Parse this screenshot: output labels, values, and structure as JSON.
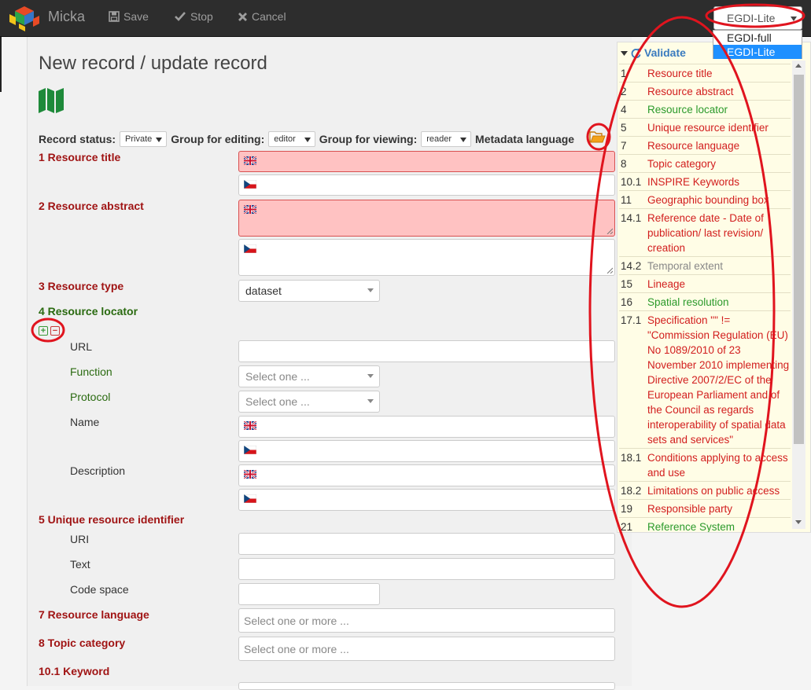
{
  "app": {
    "brand": "Micka",
    "toolbar": {
      "save_label": "Save",
      "stop_label": "Stop",
      "cancel_label": "Cancel"
    },
    "profile": {
      "selected": "EGDI-Lite",
      "options": [
        "EGDI-full",
        "EGDI-Lite"
      ]
    }
  },
  "page": {
    "title": "New record / update record"
  },
  "status_bar": {
    "record_status_label": "Record status:",
    "record_status_value": "Private",
    "group_editing_label": "Group for editing:",
    "group_editing_value": "editor",
    "group_viewing_label": "Group for viewing:",
    "group_viewing_value": "reader",
    "metadata_language_label": "Metadata language"
  },
  "form": {
    "resource_title": "1 Resource title",
    "resource_abstract": "2 Resource abstract",
    "resource_type": {
      "label": "3 Resource type",
      "value": "dataset"
    },
    "resource_locator": {
      "label": "4 Resource locator",
      "url_label": "URL",
      "function_label": "Function",
      "function_placeholder": "Select one ...",
      "protocol_label": "Protocol",
      "protocol_placeholder": "Select one ...",
      "name_label": "Name",
      "description_label": "Description"
    },
    "unique_identifier": {
      "label": "5 Unique resource identifier",
      "uri_label": "URI",
      "text_label": "Text",
      "codespace_label": "Code space"
    },
    "resource_language": {
      "label": "7 Resource language",
      "placeholder": "Select one or more ..."
    },
    "topic_category": {
      "label": "8 Topic category",
      "placeholder": "Select one or more ..."
    },
    "keyword": {
      "label": "10.1 Keyword"
    }
  },
  "validate": {
    "title": "Validate",
    "items": [
      {
        "num": "1",
        "text": "Resource title",
        "status": "error"
      },
      {
        "num": "2",
        "text": "Resource abstract",
        "status": "error"
      },
      {
        "num": "4",
        "text": "Resource locator",
        "status": "ok"
      },
      {
        "num": "5",
        "text": "Unique resource identifier",
        "status": "error"
      },
      {
        "num": "7",
        "text": "Resource language",
        "status": "error"
      },
      {
        "num": "8",
        "text": "Topic category",
        "status": "error"
      },
      {
        "num": "10.1",
        "text": "INSPIRE Keywords",
        "status": "error"
      },
      {
        "num": "11",
        "text": "Geographic bounding box",
        "status": "error"
      },
      {
        "num": "14.1",
        "text": "Reference date - Date of publication/ last revision/ creation",
        "status": "error"
      },
      {
        "num": "14.2",
        "text": "Temporal extent",
        "status": "gray"
      },
      {
        "num": "15",
        "text": "Lineage",
        "status": "error"
      },
      {
        "num": "16",
        "text": "Spatial resolution",
        "status": "ok"
      },
      {
        "num": "17.1",
        "text": "Specification \"\" != \"Commission Regulation (EU) No 1089/2010 of 23 November 2010 implementing Directive 2007/2/EC of the European Parliament and of the Council as regards interoperability of spatial data sets and services\"",
        "status": "error"
      },
      {
        "num": "18.1",
        "text": "Conditions applying to access and use",
        "status": "error"
      },
      {
        "num": "18.2",
        "text": "Limitations on public access",
        "status": "error"
      },
      {
        "num": "19",
        "text": "Responsible party",
        "status": "error"
      },
      {
        "num": "21",
        "text": "Reference System Information",
        "status": "ok"
      }
    ]
  },
  "colors": {
    "error": "#d21e1e",
    "ok": "#2b9a2b",
    "label_red": "#a01414",
    "label_green": "#2a6a10",
    "annotation": "#e0141e",
    "map_icon": "#1e8a3a"
  },
  "icons": [
    "micka-logo-icon",
    "save-icon",
    "stop-icon",
    "cancel-icon",
    "map-icon",
    "folder-icon",
    "uk-flag-icon",
    "cz-flag-icon",
    "refresh-icon",
    "plus-icon",
    "minus-icon"
  ]
}
